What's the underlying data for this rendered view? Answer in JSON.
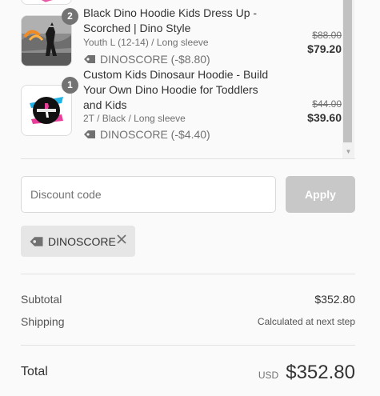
{
  "products": [
    {
      "quantity": "2",
      "title": "Black Dino Hoodie Kids Dress Up - Scorched | Dino Style",
      "variant": "Youth L (12-14) / Long sleeve",
      "discount": "DINOSCORE (-$8.80)",
      "original_price": "$88.00",
      "price": "$79.20"
    },
    {
      "quantity": "1",
      "title": "Custom Kids Dinosaur Hoodie - Build Your Own Dino Hoodie for Toddlers and Kids",
      "variant": "2T / Black / Long sleeve",
      "discount": "DINOSCORE (-$4.40)",
      "original_price": "$44.00",
      "price": "$39.60"
    }
  ],
  "discount": {
    "placeholder": "Discount code",
    "apply_label": "Apply",
    "applied_code": "DINOSCORE"
  },
  "totals": {
    "subtotal_label": "Subtotal",
    "subtotal_value": "$352.80",
    "shipping_label": "Shipping",
    "shipping_value": "Calculated at next step",
    "total_label": "Total",
    "currency": "USD",
    "total_value": "$352.80"
  },
  "colors": {
    "background": "#fafafa",
    "badge": "#737373",
    "apply_disabled": "#c8c8c8",
    "tag_background": "#e6e6e6",
    "scrollbar_thumb": "#c1c1c1"
  }
}
